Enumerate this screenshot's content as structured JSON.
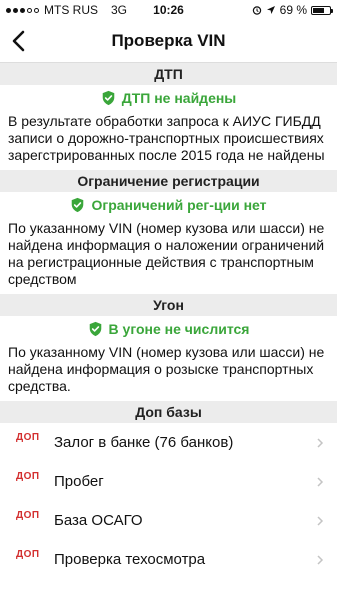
{
  "status_bar": {
    "carrier": "MTS RUS",
    "network": "3G",
    "time": "10:26",
    "battery": "69 %",
    "battery_fraction": 0.69
  },
  "nav": {
    "title": "Проверка VIN",
    "back_icon": "chevron-left-icon"
  },
  "sections": [
    {
      "header": "ДТП",
      "status": "ДТП не найдены",
      "description": "В результате обработки запроса к АИУС ГИБДД записи о дорожно-транспортных происшествиях зарегстрированных после 2015 года не найдены"
    },
    {
      "header": "Ограничение регистрации",
      "status": "Ограничений рег-ции нет",
      "description": "По указанному VIN (номер кузова или шасси) не найдена информация о наложении ограничений на регистрационные действия с транспортным средством"
    },
    {
      "header": "Угон",
      "status": "В угоне не числится",
      "description": "По указанному VIN (номер кузова или шасси) не найдена информация о розыске транспортных средства."
    }
  ],
  "extra": {
    "header": "Доп базы",
    "items": [
      {
        "badge": "ДОП",
        "label": "Залог в банке (76 банков)"
      },
      {
        "badge": "ДОП",
        "label": "Пробег"
      },
      {
        "badge": "ДОП",
        "label": "База ОСАГО"
      },
      {
        "badge": "ДОП",
        "label": "Проверка техосмотра"
      }
    ]
  },
  "colors": {
    "ok_green": "#3aa63a",
    "badge_red": "#d32f2f",
    "section_bg": "#ececec"
  }
}
